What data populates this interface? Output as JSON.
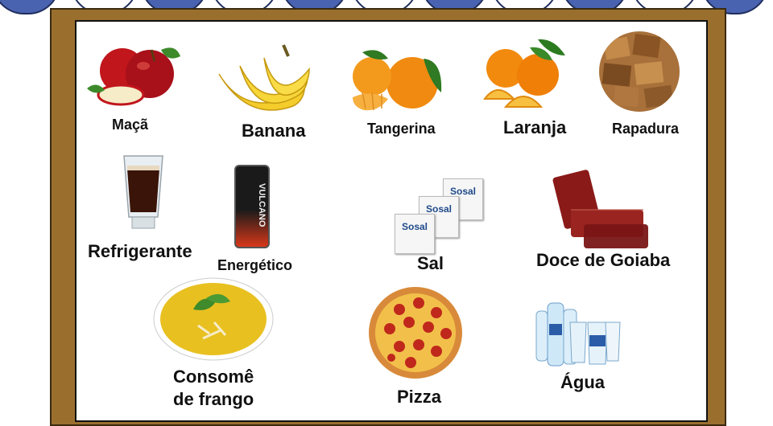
{
  "items": {
    "maca": "Maçã",
    "banana": "Banana",
    "tangerina": "Tangerina",
    "laranja": "Laranja",
    "rapadura": "Rapadura",
    "refrigerante": "Refrigerante",
    "energetico": "Energético",
    "sal": "Sal",
    "doce_goiaba": "Doce de Goiaba",
    "consome_line1": "Consomê",
    "consome_line2": "de frango",
    "pizza": "Pizza",
    "agua": "Água"
  },
  "product_text": {
    "energy_can_brand": "VULCANO",
    "salt_packet_brand": "Sosal"
  },
  "colors": {
    "awning_blue": "#4a63b0",
    "frame_brown": "#9a6f2e"
  }
}
